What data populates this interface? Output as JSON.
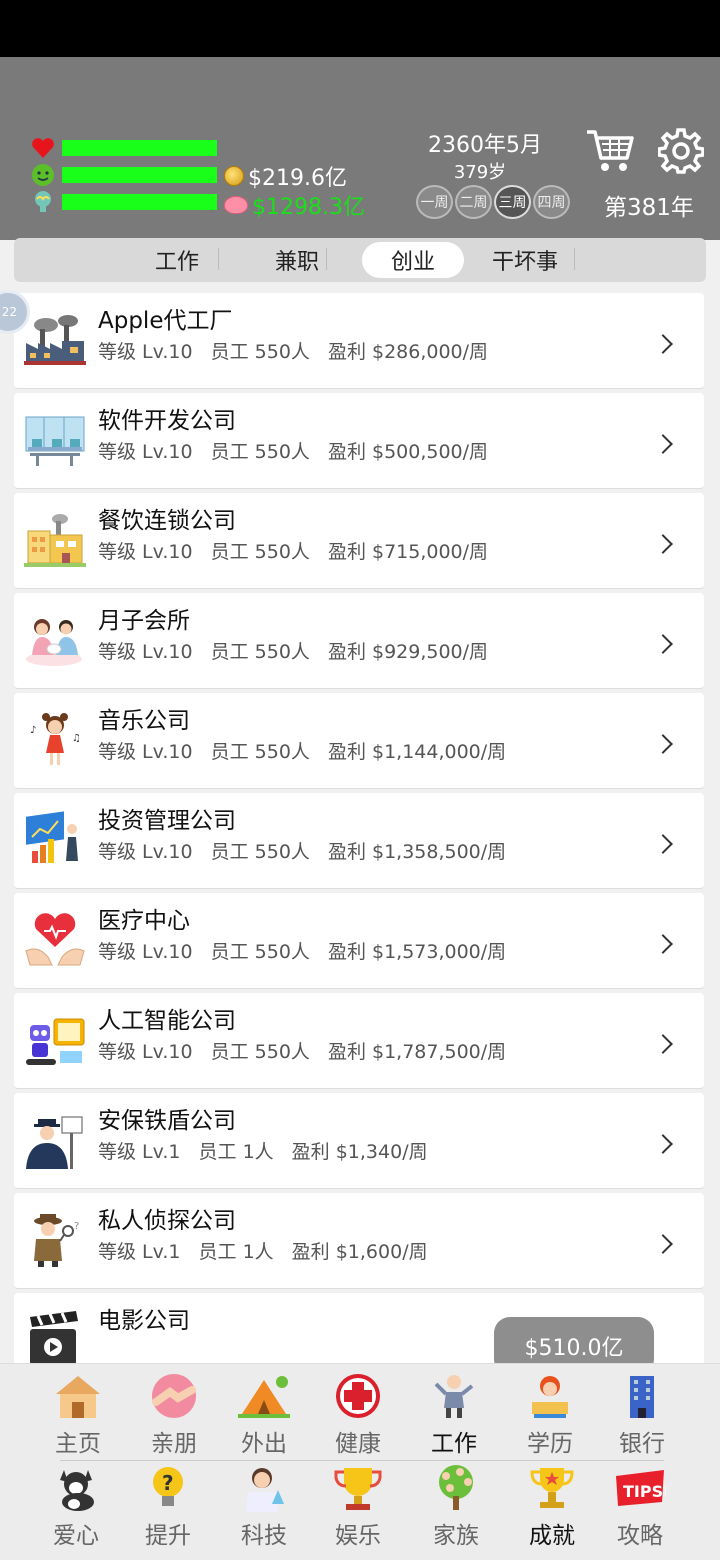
{
  "header": {
    "money": "$219.6亿",
    "savings": "$1298.3亿",
    "date": "2360年5月",
    "age": "379岁",
    "weeks": [
      "一周",
      "二周",
      "三周",
      "四周"
    ],
    "active_week_index": 2,
    "year": "第381年",
    "bars": [
      {
        "icon": "heart-icon",
        "color": "#e8141c",
        "level": 1.0
      },
      {
        "icon": "smiley-icon",
        "color": "#5cbf2a",
        "level": 1.0
      },
      {
        "icon": "brain-icon",
        "color": "#74c6b8",
        "level": 1.0
      }
    ],
    "cart_icon": "cart-icon",
    "settings_icon": "gear-icon"
  },
  "tabs": [
    "工作",
    "兼职",
    "创业",
    "干坏事"
  ],
  "active_tab_index": 2,
  "side_bubble": "22",
  "companies": [
    {
      "name": "Apple代工厂",
      "level": "等级 Lv.10",
      "staff": "员工 550人",
      "profit": "盈利 $286,000/周",
      "icon": "factory-icon"
    },
    {
      "name": "软件开发公司",
      "level": "等级 Lv.10",
      "staff": "员工 550人",
      "profit": "盈利 $500,500/周",
      "icon": "office-icon"
    },
    {
      "name": "餐饮连锁公司",
      "level": "等级 Lv.10",
      "staff": "员工 550人",
      "profit": "盈利 $715,000/周",
      "icon": "restaurant-icon"
    },
    {
      "name": "月子会所",
      "level": "等级 Lv.10",
      "staff": "员工 550人",
      "profit": "盈利 $929,500/周",
      "icon": "mother-baby-icon"
    },
    {
      "name": "音乐公司",
      "level": "等级 Lv.10",
      "staff": "员工 550人",
      "profit": "盈利 $1,144,000/周",
      "icon": "singer-icon"
    },
    {
      "name": "投资管理公司",
      "level": "等级 Lv.10",
      "staff": "员工 550人",
      "profit": "盈利 $1,358,500/周",
      "icon": "investment-icon"
    },
    {
      "name": "医疗中心",
      "level": "等级 Lv.10",
      "staff": "员工 550人",
      "profit": "盈利 $1,573,000/周",
      "icon": "heart-hands-icon"
    },
    {
      "name": "人工智能公司",
      "level": "等级 Lv.10",
      "staff": "员工 550人",
      "profit": "盈利 $1,787,500/周",
      "icon": "robot-icon"
    },
    {
      "name": "安保铁盾公司",
      "level": "等级 Lv.1",
      "staff": "员工 1人",
      "profit": "盈利 $1,340/周",
      "icon": "security-guard-icon"
    },
    {
      "name": "私人侦探公司",
      "level": "等级 Lv.1",
      "staff": "员工 1人",
      "profit": "盈利 $1,600/周",
      "icon": "detective-icon"
    },
    {
      "name": "电影公司",
      "level": "",
      "staff": "",
      "profit": "",
      "icon": "clapperboard-icon"
    }
  ],
  "float_button": "$510.0亿",
  "nav": {
    "row1": [
      {
        "label": "主页",
        "icon": "home-icon",
        "dark": false
      },
      {
        "label": "亲朋",
        "icon": "handshake-icon",
        "dark": false
      },
      {
        "label": "外出",
        "icon": "tent-icon",
        "dark": false
      },
      {
        "label": "健康",
        "icon": "medical-cross-icon",
        "dark": false
      },
      {
        "label": "工作",
        "icon": "worker-icon",
        "dark": true
      },
      {
        "label": "学历",
        "icon": "student-icon",
        "dark": false
      },
      {
        "label": "银行",
        "icon": "bank-icon",
        "dark": false
      }
    ],
    "row2": [
      {
        "label": "爱心",
        "icon": "dog-icon",
        "dark": false
      },
      {
        "label": "提升",
        "icon": "question-bulb-icon",
        "dark": false
      },
      {
        "label": "科技",
        "icon": "scientist-icon",
        "dark": false
      },
      {
        "label": "娱乐",
        "icon": "trophy-cup-icon",
        "dark": false
      },
      {
        "label": "家族",
        "icon": "family-tree-icon",
        "dark": false
      },
      {
        "label": "成就",
        "icon": "trophy-icon",
        "dark": true
      },
      {
        "label": "攻略",
        "icon": "tips-icon",
        "dark": false
      }
    ]
  }
}
